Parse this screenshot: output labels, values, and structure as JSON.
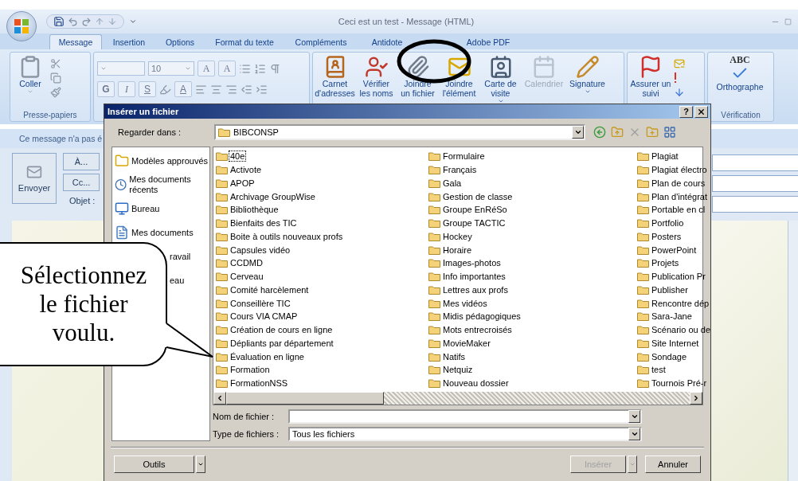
{
  "window": {
    "title": "Ceci est un test - Message (HTML)"
  },
  "ribbon_tabs": [
    {
      "label": "Message",
      "selected": true
    },
    {
      "label": "Insertion",
      "selected": false
    },
    {
      "label": "Options",
      "selected": false
    },
    {
      "label": "Format du texte",
      "selected": false
    },
    {
      "label": "Compléments",
      "selected": false
    },
    {
      "label": "Antidote",
      "selected": false
    },
    {
      "label": "Adobe PDF",
      "selected": false
    }
  ],
  "clipboard": {
    "paste": "Coller",
    "group": "Presse-papiers"
  },
  "font": {
    "size": "10",
    "grow": "A",
    "shrink": "A",
    "bold": "G",
    "italic": "I",
    "underline": "S",
    "font_color_letter": "A"
  },
  "ribbon_buttons": [
    {
      "kind": "address-book",
      "label": "Carnet d'adresses",
      "disabled": false,
      "dropdown": false
    },
    {
      "kind": "check-names",
      "label": "Vérifier les noms",
      "disabled": false,
      "dropdown": false
    },
    {
      "kind": "attach-file",
      "label": "Joindre un fichier",
      "disabled": false,
      "dropdown": false
    },
    {
      "kind": "attach-item",
      "label": "Joindre l'élément",
      "disabled": false,
      "dropdown": false
    },
    {
      "kind": "business-card",
      "label": "Carte de visite",
      "disabled": false,
      "dropdown": true
    },
    {
      "kind": "calendar",
      "label": "Calendrier",
      "disabled": true,
      "dropdown": false
    },
    {
      "kind": "signature",
      "label": "Signature",
      "disabled": false,
      "dropdown": true
    }
  ],
  "follow_up": {
    "label": "Assurer un suivi"
  },
  "proofing": {
    "icon_text": "ABC",
    "label": "Orthographe",
    "group": "Vérification"
  },
  "message": {
    "info": "Ce message n'a pas é",
    "send": "Envoyer",
    "to": "À...",
    "cc": "Cc...",
    "subject_label": "Objet :"
  },
  "dialog": {
    "title": "Insérer un fichier",
    "help": "?",
    "look_in_label": "Regarder dans :",
    "look_in": "BIBCONSP",
    "places": [
      {
        "kind": "folder",
        "label": "Modèles approuvés"
      },
      {
        "kind": "recent",
        "label": "Mes documents récents"
      },
      {
        "kind": "desktop",
        "label": "Bureau"
      },
      {
        "kind": "documents",
        "label": "Mes documents"
      },
      {
        "kind": "covered",
        "label": "ravail"
      },
      {
        "kind": "covered",
        "label": "eau"
      }
    ],
    "files": [
      {
        "name": "40e",
        "focused": true
      },
      {
        "name": "Activote",
        "focused": false
      },
      {
        "name": "APOP",
        "focused": false
      },
      {
        "name": "Archivage GroupWise",
        "focused": false
      },
      {
        "name": "Bibliothèque",
        "focused": false
      },
      {
        "name": "Bienfaits des TIC",
        "focused": false
      },
      {
        "name": "Boite à outils nouveaux profs",
        "focused": false
      },
      {
        "name": "Capsules vidéo",
        "focused": false
      },
      {
        "name": "CCDMD",
        "focused": false
      },
      {
        "name": "Cerveau",
        "focused": false
      },
      {
        "name": "Comité harcèlement",
        "focused": false
      },
      {
        "name": "Conseillère TIC",
        "focused": false
      },
      {
        "name": "Cours VIA CMAP",
        "focused": false
      },
      {
        "name": "Création de cours en ligne",
        "focused": false
      },
      {
        "name": "Dépliants par département",
        "focused": false
      },
      {
        "name": "Évaluation en ligne",
        "focused": false
      },
      {
        "name": "Formation",
        "focused": false
      },
      {
        "name": "FormationNSS",
        "focused": false
      },
      {
        "name": "Formulaire",
        "focused": false
      },
      {
        "name": "Français",
        "focused": false
      },
      {
        "name": "Gala",
        "focused": false
      },
      {
        "name": "Gestion de classe",
        "focused": false
      },
      {
        "name": "Groupe EnRéSo",
        "focused": false
      },
      {
        "name": "Groupe TACTIC",
        "focused": false
      },
      {
        "name": "Hockey",
        "focused": false
      },
      {
        "name": "Horaire",
        "focused": false
      },
      {
        "name": "Images-photos",
        "focused": false
      },
      {
        "name": "Info importantes",
        "focused": false
      },
      {
        "name": "Lettres aux profs",
        "focused": false
      },
      {
        "name": "Mes vidéos",
        "focused": false
      },
      {
        "name": "Midis pédagogiques",
        "focused": false
      },
      {
        "name": "Mots entrecroisés",
        "focused": false
      },
      {
        "name": "MovieMaker",
        "focused": false
      },
      {
        "name": "Natifs",
        "focused": false
      },
      {
        "name": "Netquiz",
        "focused": false
      },
      {
        "name": "Nouveau dossier",
        "focused": false
      },
      {
        "name": "Plagiat",
        "focused": false
      },
      {
        "name": "Plagiat électro",
        "focused": false
      },
      {
        "name": "Plan de cours",
        "focused": false
      },
      {
        "name": "Plan d'intégrat",
        "focused": false
      },
      {
        "name": "Portable en cl",
        "focused": false
      },
      {
        "name": "Portfolio",
        "focused": false
      },
      {
        "name": "Posters",
        "focused": false
      },
      {
        "name": "PowerPoint",
        "focused": false
      },
      {
        "name": "Projets",
        "focused": false
      },
      {
        "name": "Publication Pr",
        "focused": false
      },
      {
        "name": "Publisher",
        "focused": false
      },
      {
        "name": "Rencontre dép",
        "focused": false
      },
      {
        "name": "Sara-Jane",
        "focused": false
      },
      {
        "name": "Scénario ou de",
        "focused": false
      },
      {
        "name": "Site Internet",
        "focused": false
      },
      {
        "name": "Sondage",
        "focused": false
      },
      {
        "name": "test",
        "focused": false
      },
      {
        "name": "Tournois Pré-r",
        "focused": false
      }
    ],
    "filename_label": "Nom de fichier :",
    "filetype_label": "Type de fichiers :",
    "filetype": "Tous les fichiers",
    "tools": "Outils",
    "insert": {
      "label": "Insérer",
      "disabled": true
    },
    "cancel": "Annuler"
  },
  "callout": {
    "text": "Sélectionnez le fichier voulu."
  }
}
